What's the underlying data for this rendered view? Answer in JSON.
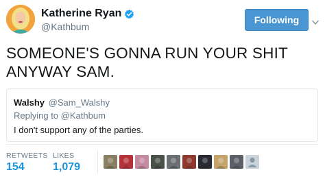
{
  "author": {
    "display_name": "Katherine Ryan",
    "handle": "@Kathbum",
    "verified": true,
    "avatar_icon": "profile-photo-blonde-woman"
  },
  "follow_button": {
    "label": "Following"
  },
  "menu": {
    "icon": "chevron-down-icon"
  },
  "tweet": {
    "text": "SOMEONE'S GONNA RUN YOUR SHIT ANYWAY SAM."
  },
  "quoted_tweet": {
    "display_name": "Walshy",
    "handle": "@Sam_Walshy",
    "replying_to_label": "Replying to",
    "replying_to_handle": "@Kathbum",
    "text": "I don't support any of the parties."
  },
  "stats": {
    "retweets_label": "RETWEETS",
    "retweets_value": "154",
    "likes_label": "LIKES",
    "likes_value": "1,079"
  },
  "liker_avatars": [
    {
      "name": "liker-1",
      "color": "#8a7f63"
    },
    {
      "name": "liker-2",
      "color": "#b4323a"
    },
    {
      "name": "liker-3",
      "color": "#c58aa0"
    },
    {
      "name": "liker-4",
      "color": "#4a5148"
    },
    {
      "name": "liker-5",
      "color": "#6b6e73"
    },
    {
      "name": "liker-6",
      "color": "#8f3a2f"
    },
    {
      "name": "liker-7",
      "color": "#2a2a33"
    },
    {
      "name": "liker-8",
      "color": "#c4a46a"
    },
    {
      "name": "liker-9",
      "color": "#5d5f66"
    },
    {
      "name": "liker-10",
      "color": "#c9d1d9"
    }
  ],
  "colors": {
    "link_blue": "#1b95e0",
    "follow_button": "#4a96d2",
    "secondary_text": "#657786",
    "verified_badge": "#1da1f2"
  }
}
